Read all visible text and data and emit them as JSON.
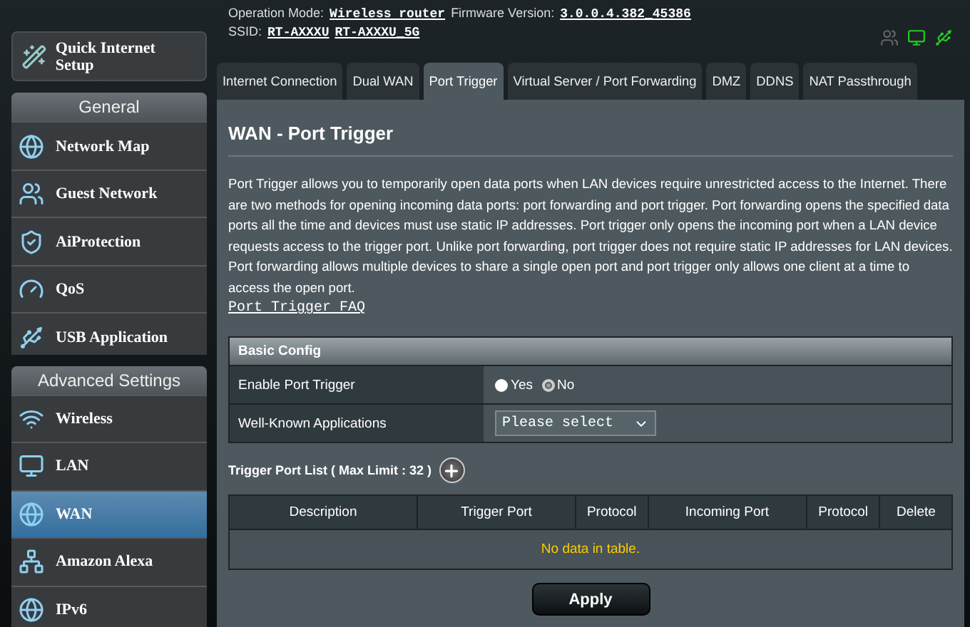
{
  "header": {
    "operation_mode_label": "Operation Mode:",
    "operation_mode": "Wireless router",
    "firmware_label": "Firmware Version:",
    "firmware": "3.0.0.4.382_45386",
    "ssid_label": "SSID:",
    "ssids": [
      "RT-AXXXU",
      "RT-AXXXU_5G"
    ]
  },
  "sidebar": {
    "quick_setup": "Quick Internet Setup",
    "sections": [
      {
        "title": "General",
        "items": [
          {
            "label": "Network Map",
            "selected": false
          },
          {
            "label": "Guest Network",
            "selected": false
          },
          {
            "label": "AiProtection",
            "selected": false
          },
          {
            "label": "QoS",
            "selected": false
          },
          {
            "label": "USB Application",
            "selected": false
          }
        ]
      },
      {
        "title": "Advanced Settings",
        "items": [
          {
            "label": "Wireless",
            "selected": false
          },
          {
            "label": "LAN",
            "selected": false
          },
          {
            "label": "WAN",
            "selected": true
          },
          {
            "label": "Amazon Alexa",
            "selected": false
          },
          {
            "label": "IPv6",
            "selected": false
          }
        ]
      }
    ]
  },
  "tabs": [
    {
      "label": "Internet Connection",
      "selected": false
    },
    {
      "label": "Dual WAN",
      "selected": false
    },
    {
      "label": "Port Trigger",
      "selected": true
    },
    {
      "label": "Virtual Server / Port Forwarding",
      "selected": false
    },
    {
      "label": "DMZ",
      "selected": false
    },
    {
      "label": "DDNS",
      "selected": false
    },
    {
      "label": "NAT Passthrough",
      "selected": false
    }
  ],
  "content": {
    "title": "WAN - Port Trigger",
    "description": "Port Trigger allows you to temporarily open data ports when LAN devices require unrestricted access to the Internet. There are two methods for opening incoming data ports: port forwarding and port trigger. Port forwarding opens the specified data ports all the time and devices must use static IP addresses. Port trigger only opens the incoming port when a LAN device requests access to the trigger port. Unlike port forwarding, port trigger does not require static IP addresses for LAN devices. Port forwarding allows multiple devices to share a single open port and port trigger only allows one client at a time to access the open port.",
    "faq_link": "Port Trigger FAQ",
    "basic_config": {
      "title": "Basic Config",
      "rows": [
        {
          "kind": "radio",
          "label": "Enable Port Trigger",
          "options": [
            {
              "label": "Yes",
              "selected": false
            },
            {
              "label": "No",
              "selected": true
            }
          ]
        },
        {
          "kind": "select",
          "label": "Well-Known Applications",
          "value": "Please select"
        }
      ]
    },
    "trigger_list": {
      "title": "Trigger Port List ( Max Limit : 32 )",
      "columns": [
        "Description",
        "Trigger Port",
        "Protocol",
        "Incoming Port",
        "Protocol",
        "Delete"
      ],
      "empty_text": "No data in table."
    },
    "apply": "Apply"
  }
}
